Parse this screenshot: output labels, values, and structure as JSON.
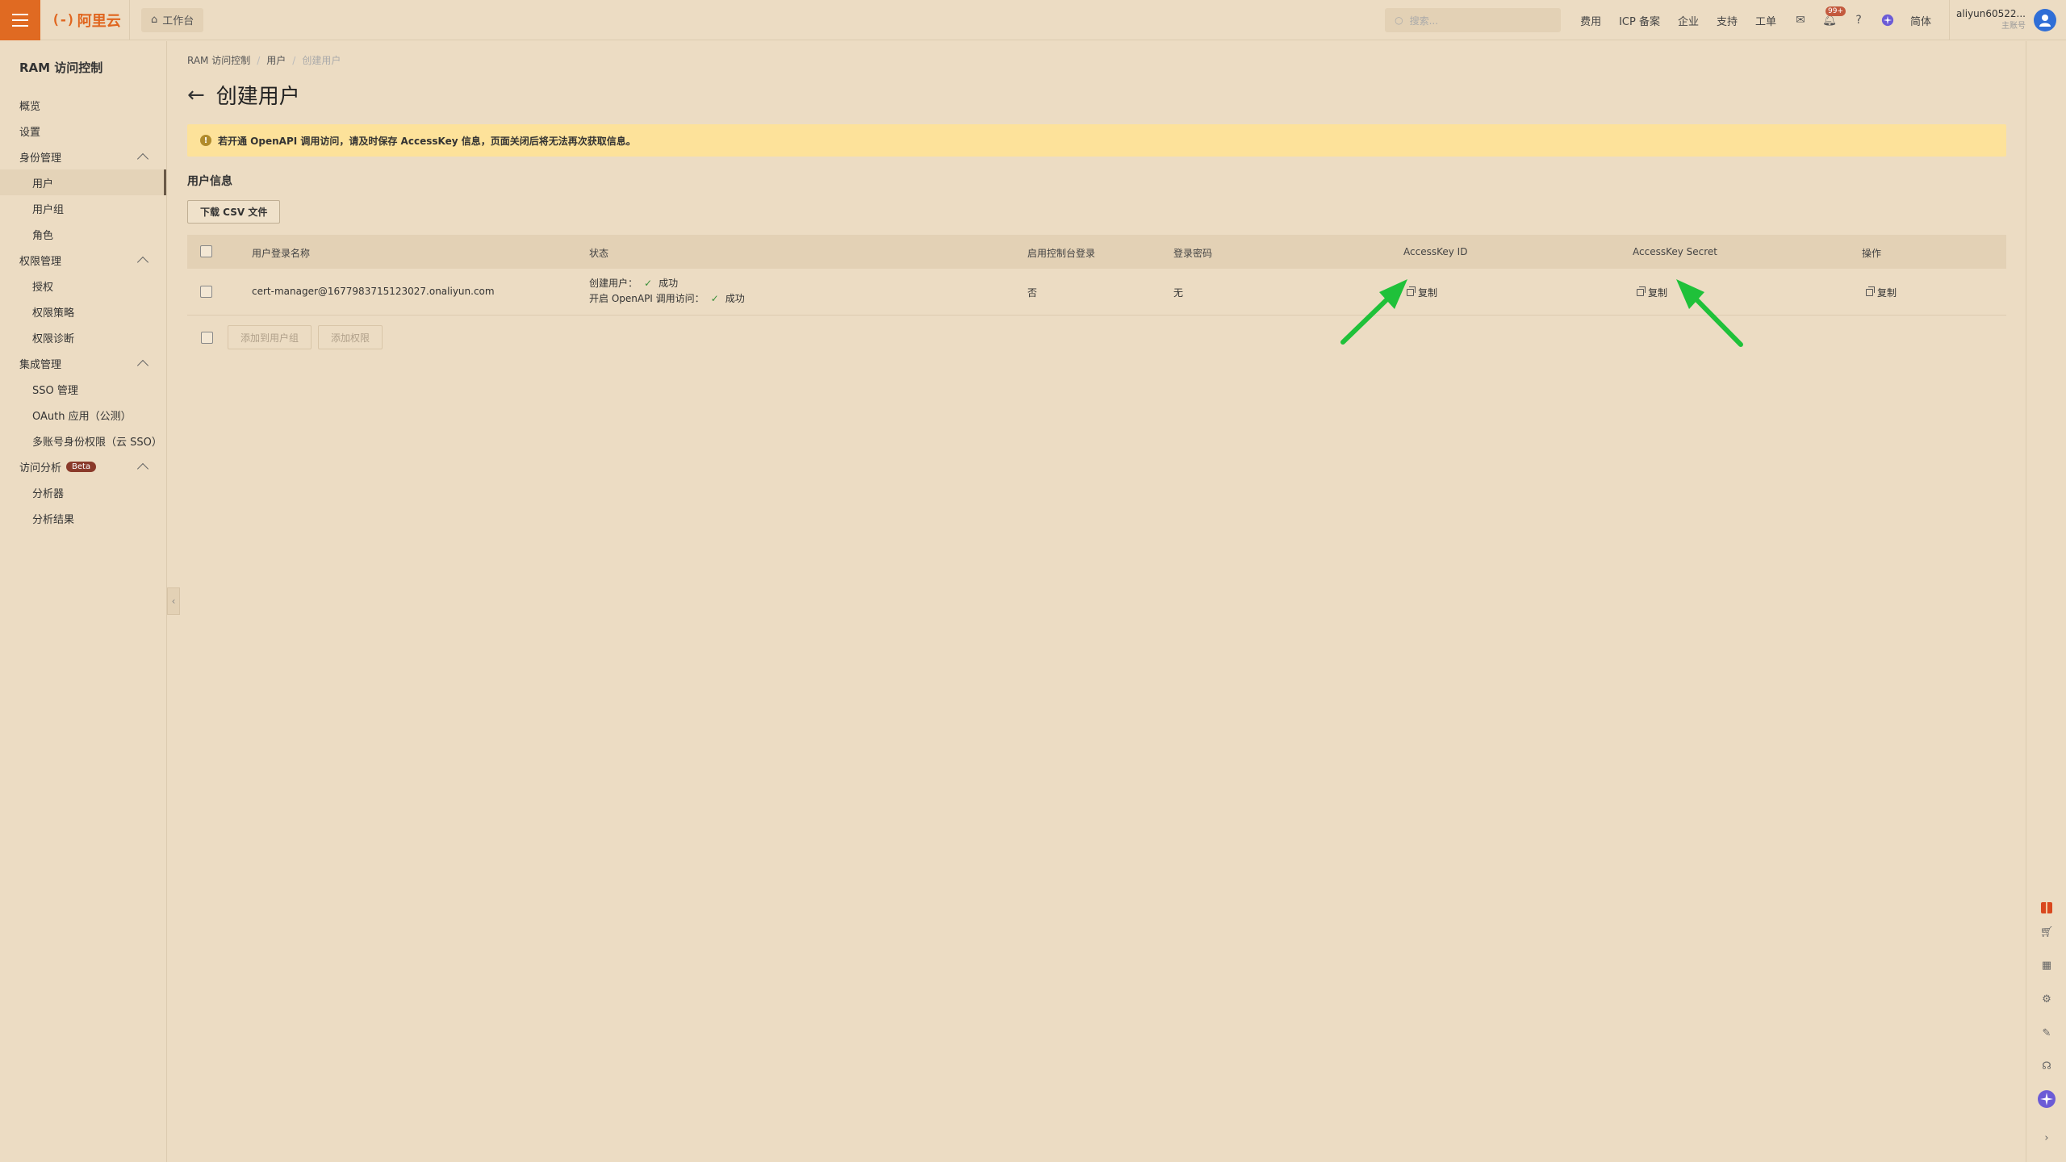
{
  "topbar": {
    "logo_text": "阿里云",
    "logo_mark": "(-)",
    "workbench": "工作台",
    "search_placeholder": "搜索...",
    "links": [
      "费用",
      "ICP 备案",
      "企业",
      "支持",
      "工单"
    ],
    "notification_badge": "99+",
    "language": "简体",
    "user_name": "aliyun60522...",
    "user_sub": "主账号"
  },
  "sidebar": {
    "title": "RAM 访问控制",
    "items": [
      {
        "label": "概览",
        "type": "item"
      },
      {
        "label": "设置",
        "type": "item"
      },
      {
        "label": "身份管理",
        "type": "group"
      },
      {
        "label": "用户",
        "type": "sub",
        "active": true
      },
      {
        "label": "用户组",
        "type": "sub"
      },
      {
        "label": "角色",
        "type": "sub"
      },
      {
        "label": "权限管理",
        "type": "group"
      },
      {
        "label": "授权",
        "type": "sub"
      },
      {
        "label": "权限策略",
        "type": "sub"
      },
      {
        "label": "权限诊断",
        "type": "sub"
      },
      {
        "label": "集成管理",
        "type": "group"
      },
      {
        "label": "SSO 管理",
        "type": "sub"
      },
      {
        "label": "OAuth 应用（公测）",
        "type": "sub"
      },
      {
        "label": "多账号身份权限（云 SSO）",
        "type": "sub"
      },
      {
        "label": "访问分析",
        "type": "group",
        "badge": "Beta"
      },
      {
        "label": "分析器",
        "type": "sub"
      },
      {
        "label": "分析结果",
        "type": "sub"
      }
    ]
  },
  "breadcrumb": [
    "RAM 访问控制",
    "用户",
    "创建用户"
  ],
  "page_title": "创建用户",
  "alert": "若开通 OpenAPI 调用访问，请及时保存 AccessKey 信息，页面关闭后将无法再次获取信息。",
  "section_title": "用户信息",
  "csv_button": "下载 CSV 文件",
  "table": {
    "headers": [
      "用户登录名称",
      "状态",
      "启用控制台登录",
      "登录密码",
      "AccessKey ID",
      "AccessKey Secret",
      "操作"
    ],
    "row": {
      "login_name": "cert-manager@1677983715123027.onaliyun.com",
      "status_1_label": "创建用户：",
      "status_1_value": "成功",
      "status_2_label": "开启 OpenAPI 调用访问：",
      "status_2_value": "成功",
      "console_login": "否",
      "password": "无",
      "accesskey_id_action": "复制",
      "accesskey_secret_action": "复制",
      "operation_action": "复制"
    }
  },
  "bottom_buttons": [
    "添加到用户组",
    "添加权限"
  ],
  "colors": {
    "accent": "#e06a22",
    "alert_bg": "#fde29a",
    "arrow": "#1fc13a"
  }
}
